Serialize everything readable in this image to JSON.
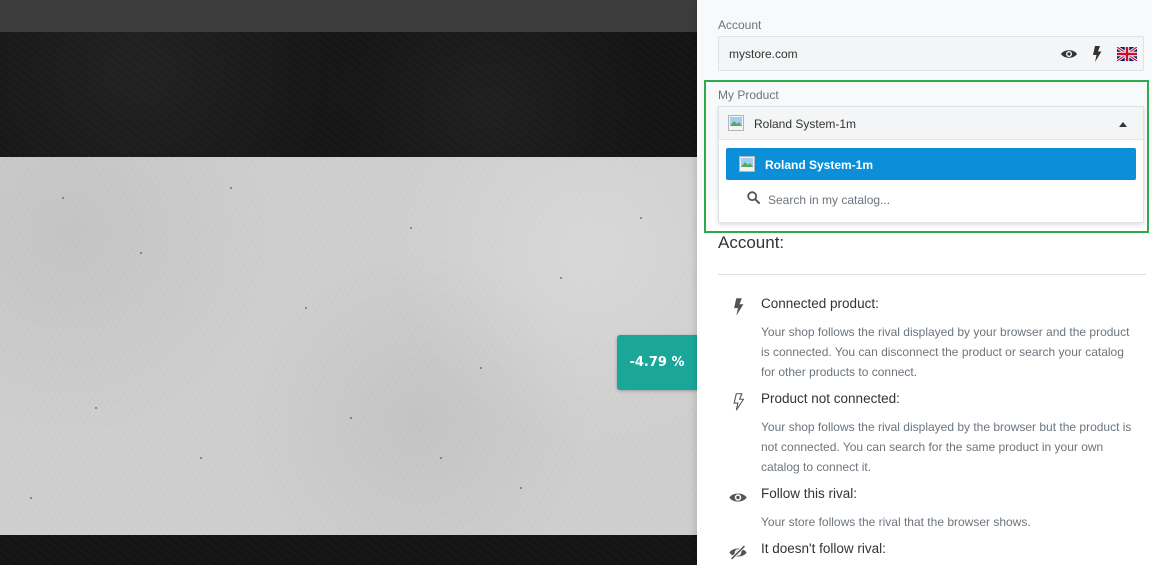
{
  "background": {
    "discount_badge": "-4.79 %"
  },
  "panel": {
    "account_label": "Account",
    "account_value": "mystore.com",
    "account_icons": [
      "eye-icon",
      "lightning-icon",
      "uk-flag-icon"
    ],
    "product_label": "My Product",
    "selected_product": "Roland System-1m",
    "dropdown": {
      "option_selected": "Roland System-1m",
      "search_placeholder": "Search in my catalog..."
    },
    "section_title": "Account:",
    "legend": [
      {
        "icon": "lightning-filled-icon",
        "title": "Connected product:",
        "desc": "Your shop follows the rival displayed by your browser and the product is connected. You can disconnect the product or search your catalog for other products to connect."
      },
      {
        "icon": "lightning-outline-icon",
        "title": "Product not connected:",
        "desc": "Your shop follows the rival displayed by the browser but the product is not connected. You can search for the same product in your own catalog to connect it."
      },
      {
        "icon": "eye-icon",
        "title": "Follow this rival:",
        "desc": "Your store follows the rival that the browser shows."
      },
      {
        "icon": "eye-slash-icon",
        "title": "It doesn't follow rival:",
        "desc": ""
      }
    ],
    "colors": {
      "selected_option": "#0b8fd9",
      "highlight_border": "#2eaa4b",
      "badge": "#1aa79a"
    }
  }
}
